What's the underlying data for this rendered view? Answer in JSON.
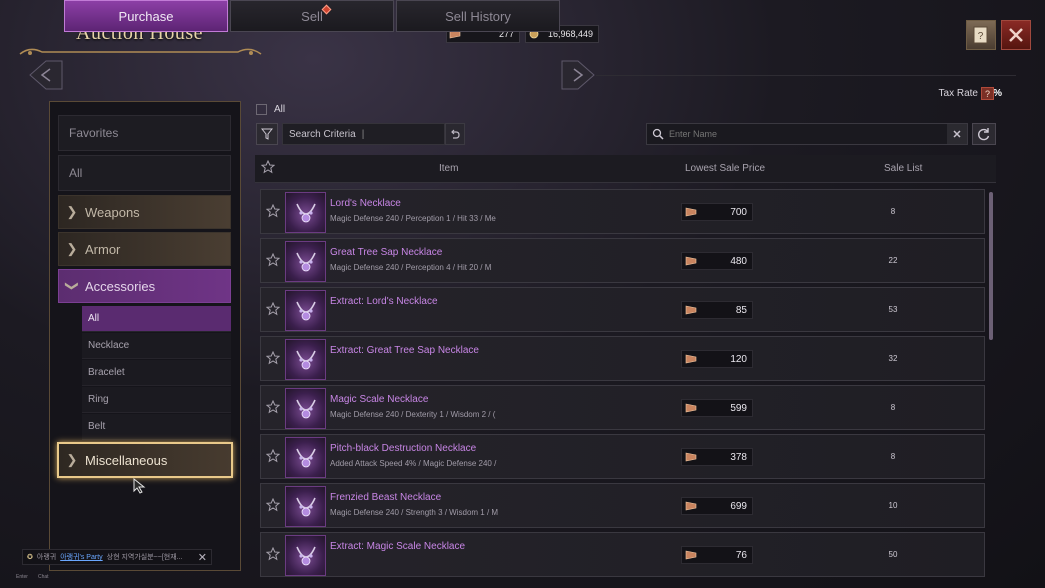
{
  "window": {
    "title": "Auction House"
  },
  "currency": {
    "tickets": "277",
    "gold": "16,968,449"
  },
  "tabs": [
    {
      "label": "Purchase",
      "active": true
    },
    {
      "label": "Sell",
      "badge": true
    },
    {
      "label": "Sell History"
    }
  ],
  "tax": {
    "label": "Tax Rate",
    "value": "21%",
    "help": "?"
  },
  "sidebar": {
    "favorites": "Favorites",
    "all": "All",
    "categories": [
      {
        "label": "Weapons"
      },
      {
        "label": "Armor"
      },
      {
        "label": "Accessories",
        "open": true
      }
    ],
    "subcategories": [
      "All",
      "Necklace",
      "Bracelet",
      "Ring",
      "Belt"
    ],
    "misc": "Miscellaneous"
  },
  "filters": {
    "all_label": "All",
    "search_criteria": "Search Criteria",
    "name_placeholder": "Enter Name"
  },
  "table": {
    "headers": {
      "item": "Item",
      "price": "Lowest Sale Price",
      "count": "Sale List"
    },
    "rows": [
      {
        "name": "Lord's Necklace",
        "stats": "Magic Defense 240 / Perception 1 / Hit 33 / Me",
        "price": "700",
        "count": "8"
      },
      {
        "name": "Great Tree Sap Necklace",
        "stats": "Magic Defense 240 / Perception 4 / Hit 20 / M",
        "price": "480",
        "count": "22"
      },
      {
        "name": "Extract: Lord's Necklace",
        "stats": "",
        "price": "85",
        "count": "53"
      },
      {
        "name": "Extract: Great Tree Sap Necklace",
        "stats": "",
        "price": "120",
        "count": "32"
      },
      {
        "name": "Magic Scale Necklace",
        "stats": "Magic Defense 240 / Dexterity 1 / Wisdom 2 / (",
        "price": "599",
        "count": "8"
      },
      {
        "name": "Pitch-black Destruction Necklace",
        "stats": "Added Attack Speed 4% / Magic Defense 240 /",
        "price": "378",
        "count": "8"
      },
      {
        "name": "Frenzied Beast Necklace",
        "stats": "Magic Defense 240 / Strength 3 / Wisdom 1 / M",
        "price": "699",
        "count": "10"
      },
      {
        "name": "Extract: Magic Scale Necklace",
        "stats": "",
        "price": "76",
        "count": "50"
      }
    ]
  },
  "chat": {
    "prefix": "아랭귀",
    "link": "아랭귀's Party",
    "text": "상현 지역가실분~~[현재..."
  },
  "bottom": {
    "enter": "Enter",
    "chat": "Chat"
  },
  "colors": {
    "accent": "#8c3fa6",
    "item_name": "#c886e6",
    "gold_border": "#e9c98a"
  }
}
